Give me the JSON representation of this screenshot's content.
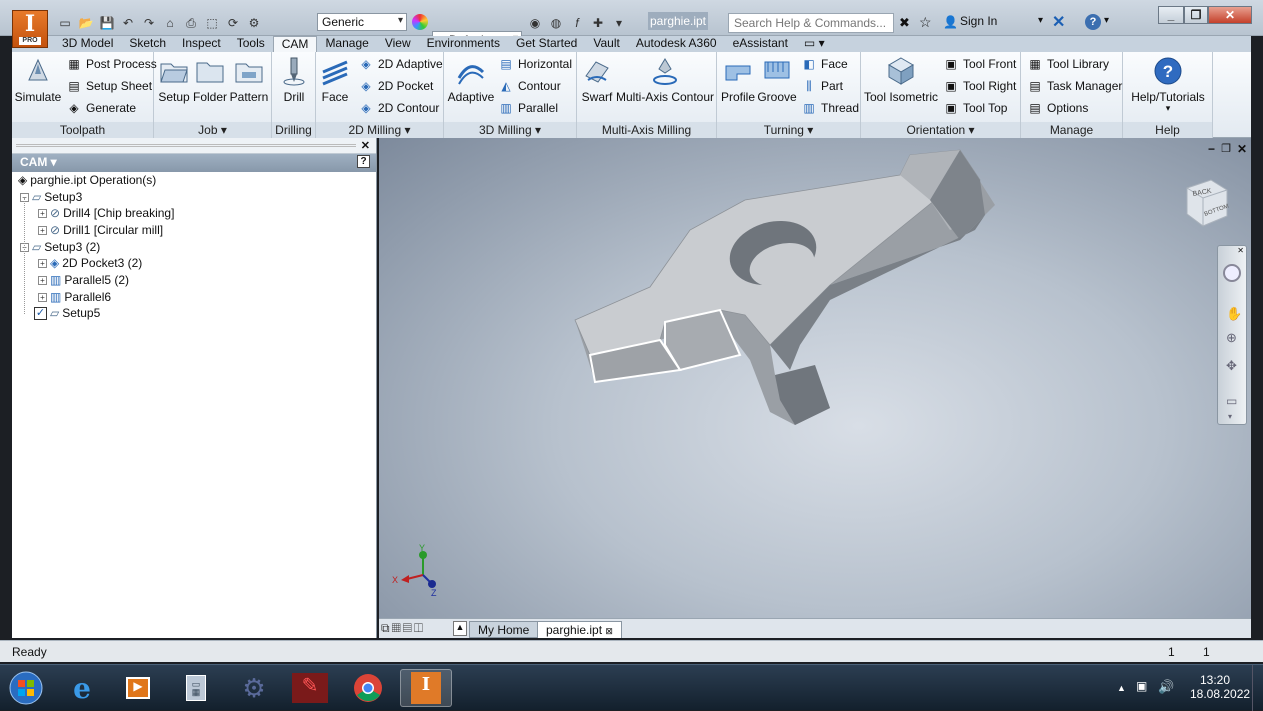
{
  "titlebar": {
    "document": "parghie.ipt",
    "search_placeholder": "Search Help & Commands...",
    "sign_in": "Sign In",
    "material": "Generic",
    "appearance": "Default",
    "app_pro": "PRO",
    "app_letter": "I"
  },
  "tabs": [
    "3D Model",
    "Sketch",
    "Inspect",
    "Tools",
    "CAM",
    "Manage",
    "View",
    "Environments",
    "Get Started",
    "Vault",
    "Autodesk A360",
    "eAssistant"
  ],
  "active_tab": "CAM",
  "ribbon": {
    "toolpath": {
      "label": "Toolpath",
      "simulate": "Simulate",
      "post_process": "Post Process",
      "setup_sheet": "Setup Sheet",
      "generate": "Generate"
    },
    "job": {
      "label": "Job",
      "setup": "Setup",
      "folder": "Folder",
      "pattern": "Pattern"
    },
    "drilling": {
      "label": "Drilling",
      "drill": "Drill"
    },
    "milling2d": {
      "label": "2D Milling",
      "face": "Face",
      "adaptive": "2D Adaptive",
      "pocket": "2D Pocket",
      "contour": "2D Contour"
    },
    "milling3d": {
      "label": "3D Milling",
      "adaptive": "Adaptive",
      "horizontal": "Horizontal",
      "contour": "Contour",
      "parallel": "Parallel"
    },
    "multiaxis": {
      "label": "Multi-Axis Milling",
      "swarf": "Swarf",
      "contour": "Multi-Axis Contour"
    },
    "turning": {
      "label": "Turning",
      "profile": "Profile",
      "groove": "Groove",
      "face": "Face",
      "part": "Part",
      "thread": "Thread"
    },
    "orientation": {
      "label": "Orientation",
      "isometric": "Tool Isometric",
      "front": "Tool Front",
      "right": "Tool Right",
      "top": "Tool Top"
    },
    "manage": {
      "label": "Manage",
      "library": "Tool Library",
      "task": "Task Manager",
      "options": "Options"
    },
    "help": {
      "label": "Help",
      "tutorials": "Help/Tutorials"
    }
  },
  "browser": {
    "title": "CAM",
    "root": "parghie.ipt Operation(s)",
    "nodes": [
      {
        "label": "Setup3"
      },
      {
        "label": "Drill4 [Chip breaking]"
      },
      {
        "label": "Drill1 [Circular mill]"
      },
      {
        "label": "Setup3 (2)"
      },
      {
        "label": "2D Pocket3 (2)"
      },
      {
        "label": "Parallel5 (2)"
      },
      {
        "label": "Parallel6"
      },
      {
        "label": "Setup5"
      }
    ]
  },
  "viewcube": {
    "face1": "BACK",
    "face2": "BOTTOM"
  },
  "axes": {
    "x": "X",
    "y": "Y",
    "z": "Z"
  },
  "doc_tabs": {
    "home": "My Home",
    "doc": "parghie.ipt"
  },
  "status": {
    "text": "Ready",
    "count1": "1",
    "count2": "1"
  },
  "clock": {
    "time": "13:20",
    "date": "18.08.2022"
  },
  "taskbar_icons": [
    "windows-start-icon",
    "internet-explorer-icon",
    "media-center-icon",
    "calculator-icon",
    "gear-tool-icon",
    "feather-app-icon",
    "chrome-icon",
    "inventor-icon"
  ]
}
